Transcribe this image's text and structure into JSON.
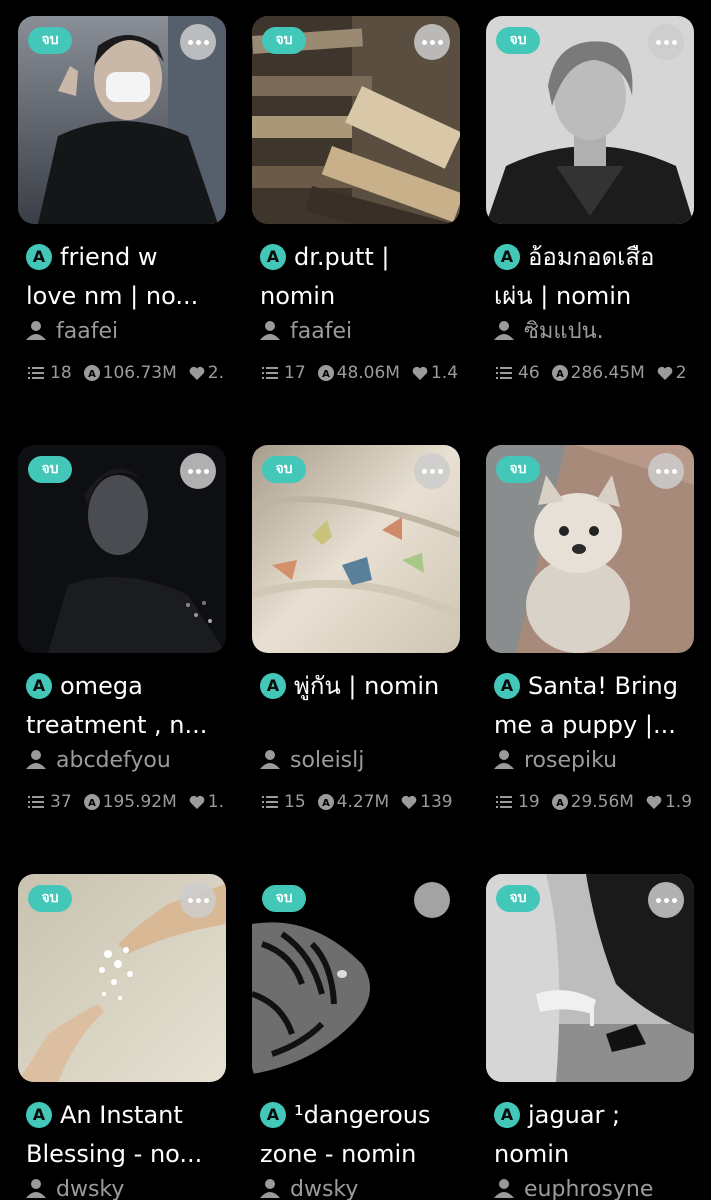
{
  "cards": [
    {
      "badge": "จบ",
      "title_line1": "friend w",
      "title_line2": "love nm | no...",
      "author": "faafei",
      "chapters": "18",
      "views": "106.73M",
      "likes": "2."
    },
    {
      "badge": "จบ",
      "title_line1": "dr.putt |",
      "title_line2": "nomin",
      "author": "faafei",
      "chapters": "17",
      "views": "48.06M",
      "likes": "1.4"
    },
    {
      "badge": "จบ",
      "title_line1": "อ้อมกอดเสือ",
      "title_line2": "เผ่น | nomin",
      "author": "ซิมแปน.",
      "chapters": "46",
      "views": "286.45M",
      "likes": "2"
    },
    {
      "badge": "จบ",
      "title_line1": "omega",
      "title_line2": "treatment , n...",
      "author": "abcdefyou",
      "chapters": "37",
      "views": "195.92M",
      "likes": "1."
    },
    {
      "badge": "จบ",
      "title_line1": "พู่กัน | nomin",
      "title_line2": "",
      "author": "soleislj",
      "chapters": "15",
      "views": "4.27M",
      "likes": "139"
    },
    {
      "badge": "จบ",
      "title_line1": "Santa! Bring",
      "title_line2": "me a puppy |...",
      "author": "rosepiku",
      "chapters": "19",
      "views": "29.56M",
      "likes": "1.9"
    },
    {
      "badge": "จบ",
      "title_line1": "An Instant",
      "title_line2": "Blessing - no...",
      "author": "dwsky",
      "chapters": "",
      "views": "",
      "likes": ""
    },
    {
      "badge": "จบ",
      "title_line1": "¹dangerous",
      "title_line2": "zone - nomin",
      "author": "dwsky",
      "chapters": "",
      "views": "",
      "likes": ""
    },
    {
      "badge": "จบ",
      "title_line1": "jaguar ;",
      "title_line2": "nomin",
      "author": "euphrosyne",
      "chapters": "",
      "views": "",
      "likes": ""
    }
  ],
  "icons": {
    "title_icon": "A",
    "author_icon": "user-icon",
    "chapters_icon": "list-icon",
    "views_icon": "eye-badge-icon",
    "likes_icon": "heart-icon",
    "more_icon": "more-dots-icon"
  },
  "colors": {
    "background": "#000000",
    "accent": "#43c7b9",
    "muted_text": "#9b9b9b"
  }
}
